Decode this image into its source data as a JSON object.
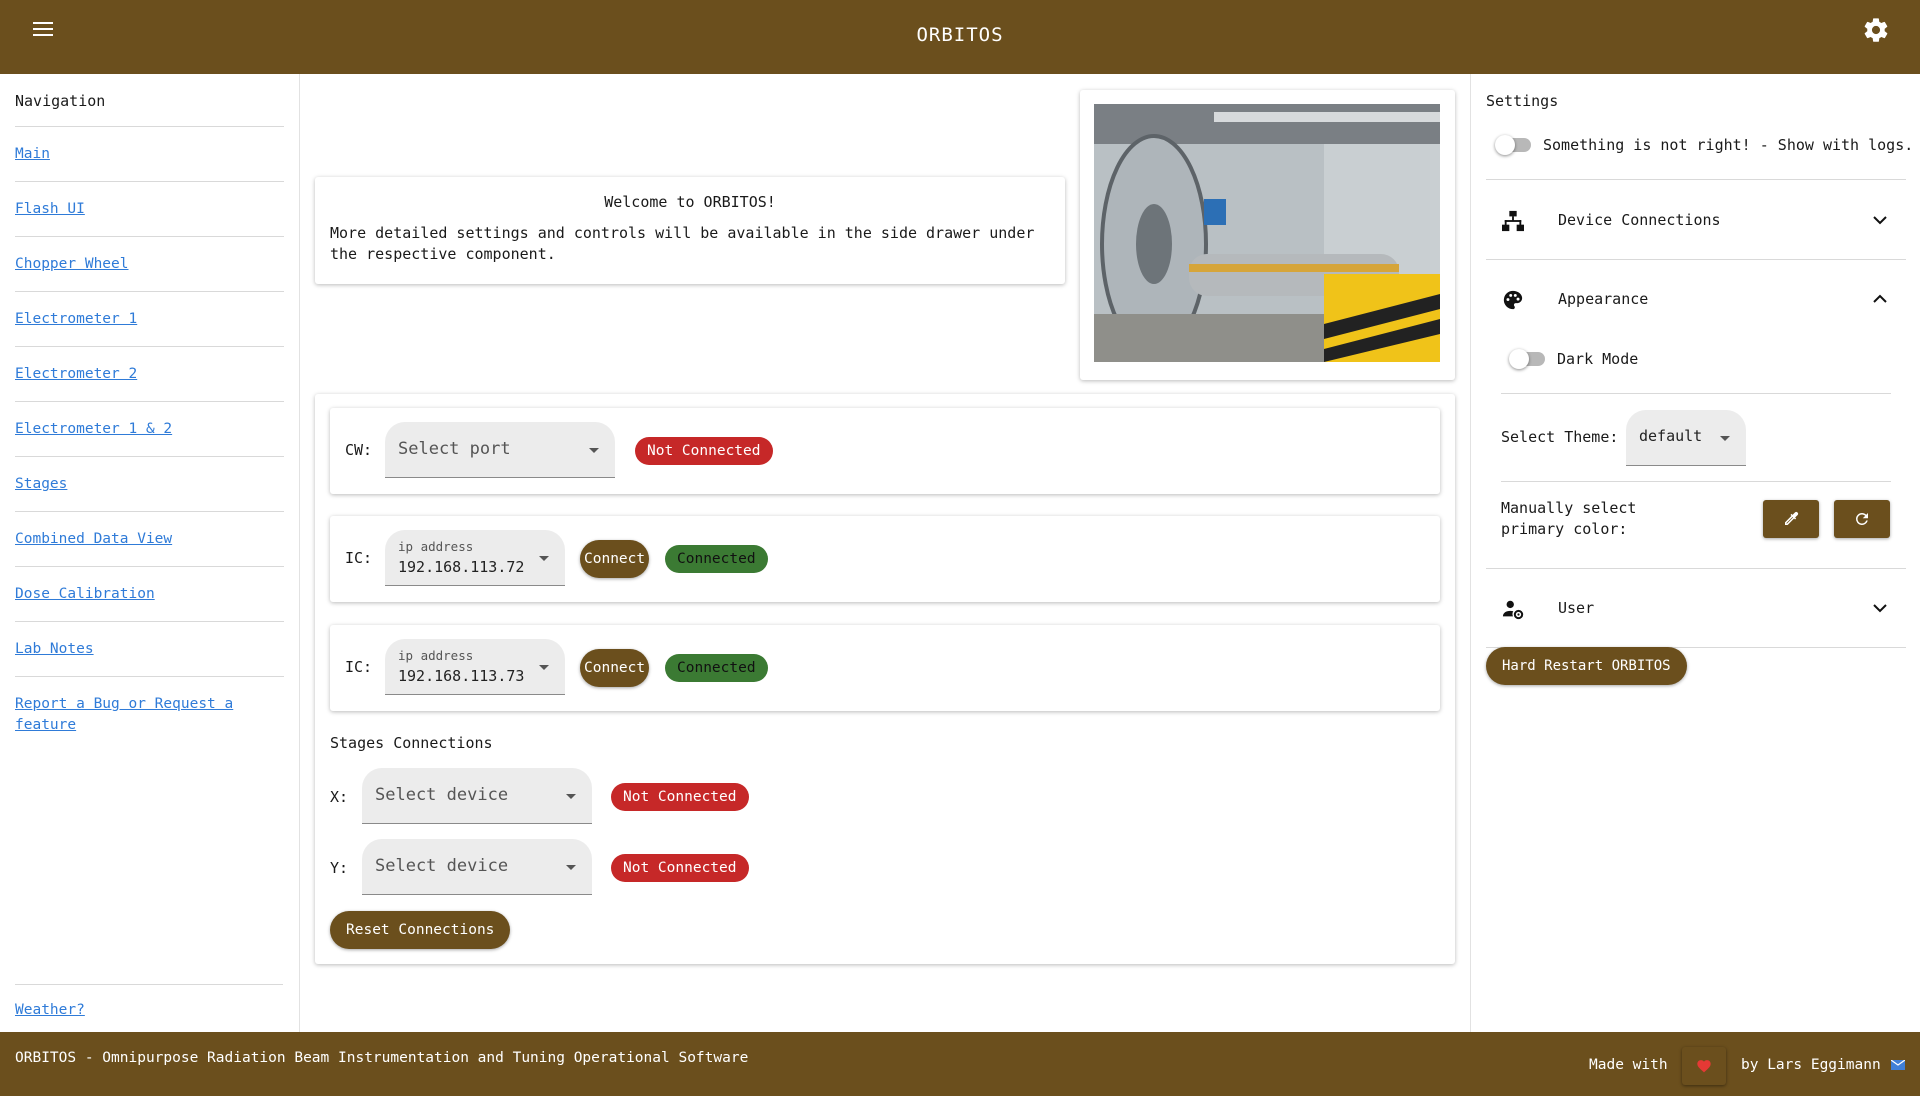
{
  "header": {
    "title": "ORBITOS"
  },
  "nav": {
    "title": "Navigation",
    "items": [
      {
        "label": "Main"
      },
      {
        "label": "Flash UI"
      },
      {
        "label": "Chopper Wheel"
      },
      {
        "label": "Electrometer 1"
      },
      {
        "label": "Electrometer 2"
      },
      {
        "label": "Electrometer 1 & 2"
      },
      {
        "label": "Stages"
      },
      {
        "label": "Combined Data View"
      },
      {
        "label": "Dose Calibration"
      },
      {
        "label": "Lab Notes"
      },
      {
        "label": "Report a Bug or Request a feature"
      }
    ],
    "weather": "Weather?"
  },
  "welcome": {
    "title": "Welcome to ORBITOS!",
    "body": "More detailed settings and controls will be available in the side drawer under the respective component."
  },
  "connections": {
    "cw": {
      "label": "CW:",
      "placeholder": "Select port",
      "status": "Not Connected"
    },
    "ic1": {
      "label": "IC:",
      "caption": "ip address",
      "value": "192.168.113.72",
      "button": "Connect",
      "status": "Connected"
    },
    "ic2": {
      "label": "IC:",
      "caption": "ip address",
      "value": "192.168.113.73",
      "button": "Connect",
      "status": "Connected"
    },
    "stages_title": "Stages Connections",
    "x": {
      "label": "X:",
      "placeholder": "Select device",
      "status": "Not Connected"
    },
    "y": {
      "label": "Y:",
      "placeholder": "Select device",
      "status": "Not Connected"
    },
    "reset_button": "Reset Connections"
  },
  "settings": {
    "title": "Settings",
    "logs_toggle_label": "Something is not right! - Show with logs.",
    "device_connections": "Device Connections",
    "appearance": "Appearance",
    "dark_mode": "Dark Mode",
    "select_theme_label": "Select Theme:",
    "theme_value": "default",
    "primary_color_label": "Manually select primary color:",
    "user": "User",
    "restart_button": "Hard Restart ORBITOS"
  },
  "footer": {
    "text": "ORBITOS - Omnipurpose Radiation Beam Instrumentation and Tuning Operational Software",
    "made_with": "Made with",
    "by": "by Lars Eggimann"
  },
  "colors": {
    "primary": "#6b4f1d",
    "link": "#2f7bd8",
    "connected": "#3b7a33",
    "not_connected": "#c62828"
  },
  "icons": [
    "menu-icon",
    "gear-icon",
    "sitemap-icon",
    "palette-icon",
    "user-cog-icon",
    "chevron-down-icon",
    "chevron-up-icon",
    "eyedropper-icon",
    "refresh-icon",
    "heart-icon",
    "mail-icon",
    "dropdown-arrow-icon"
  ]
}
